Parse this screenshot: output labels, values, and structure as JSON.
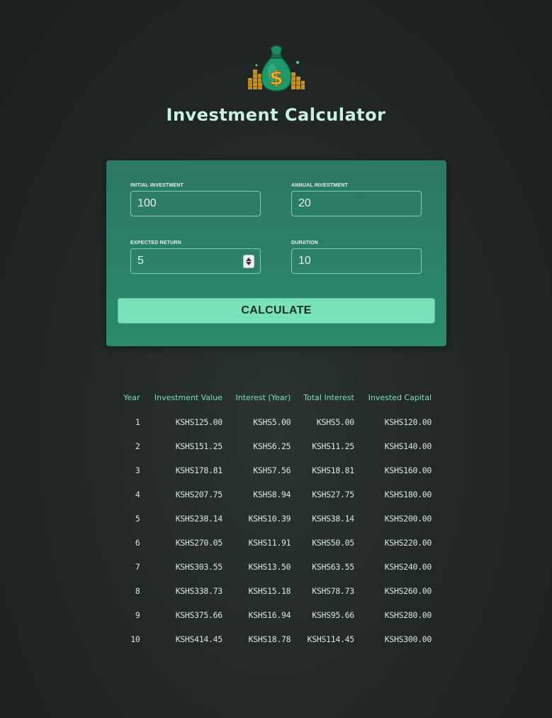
{
  "header": {
    "logo_icon": "money-bag-dollar-icon",
    "title": "Investment Calculator"
  },
  "form": {
    "initial_investment": {
      "label": "Initial Investment",
      "value": "100"
    },
    "annual_investment": {
      "label": "Annual Investment",
      "value": "20"
    },
    "expected_return": {
      "label": "Expected Return",
      "value": "5"
    },
    "duration": {
      "label": "Duration",
      "value": "10"
    },
    "calculate_label": "CALCULATE"
  },
  "results": {
    "columns": [
      "Year",
      "Investment Value",
      "Interest (Year)",
      "Total Interest",
      "Invested Capital"
    ],
    "rows": [
      [
        "1",
        "KSHS125.00",
        "KSHS5.00",
        "KSHS5.00",
        "KSHS120.00"
      ],
      [
        "2",
        "KSHS151.25",
        "KSHS6.25",
        "KSHS11.25",
        "KSHS140.00"
      ],
      [
        "3",
        "KSHS178.81",
        "KSHS7.56",
        "KSHS18.81",
        "KSHS160.00"
      ],
      [
        "4",
        "KSHS207.75",
        "KSHS8.94",
        "KSHS27.75",
        "KSHS180.00"
      ],
      [
        "5",
        "KSHS238.14",
        "KSHS10.39",
        "KSHS38.14",
        "KSHS200.00"
      ],
      [
        "6",
        "KSHS270.05",
        "KSHS11.91",
        "KSHS50.05",
        "KSHS220.00"
      ],
      [
        "7",
        "KSHS303.55",
        "KSHS13.50",
        "KSHS63.55",
        "KSHS240.00"
      ],
      [
        "8",
        "KSHS338.73",
        "KSHS15.18",
        "KSHS78.73",
        "KSHS260.00"
      ],
      [
        "9",
        "KSHS375.66",
        "KSHS16.94",
        "KSHS95.66",
        "KSHS280.00"
      ],
      [
        "10",
        "KSHS414.45",
        "KSHS18.78",
        "KSHS114.45",
        "KSHS300.00"
      ]
    ]
  },
  "colors": {
    "accent": "#7ae2b8",
    "card": "#2b8a6c",
    "background": "#222826"
  }
}
